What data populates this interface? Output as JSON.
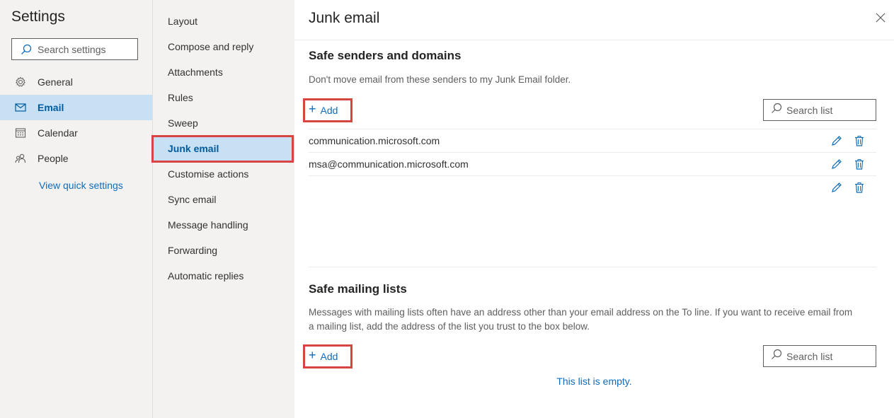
{
  "settings": {
    "title": "Settings",
    "search_placeholder": "Search settings",
    "nav": [
      {
        "label": "General",
        "icon": "gear-icon",
        "selected": false
      },
      {
        "label": "Email",
        "icon": "mail-icon",
        "selected": true
      },
      {
        "label": "Calendar",
        "icon": "calendar-icon",
        "selected": false
      },
      {
        "label": "People",
        "icon": "people-icon",
        "selected": false
      }
    ],
    "quick_settings_link": "View quick settings"
  },
  "email_nav": [
    "Layout",
    "Compose and reply",
    "Attachments",
    "Rules",
    "Sweep",
    "Junk email",
    "Customise actions",
    "Sync email",
    "Message handling",
    "Forwarding",
    "Automatic replies"
  ],
  "email_nav_selected": "Junk email",
  "content": {
    "title": "Junk email",
    "safe_senders": {
      "title": "Safe senders and domains",
      "description": "Don't move email from these senders to my Junk Email folder.",
      "add_label": "Add",
      "search_placeholder": "Search list",
      "items": [
        "communication.microsoft.com",
        "msa@communication.microsoft.com",
        ""
      ]
    },
    "safe_mailing_lists": {
      "title": "Safe mailing lists",
      "description_line1": "Messages with mailing lists often have an address other than your email address on the To line. If you want to receive email from",
      "description_line2": "a mailing list, add the address of the list you trust to the box below.",
      "add_label": "Add",
      "search_placeholder": "Search list",
      "empty_text": "This list is empty."
    }
  },
  "colors": {
    "accent": "#0f6cbd",
    "selected_bg": "#c7e0f4",
    "highlight": "#d64541",
    "pane_bg": "#f3f2f1"
  }
}
